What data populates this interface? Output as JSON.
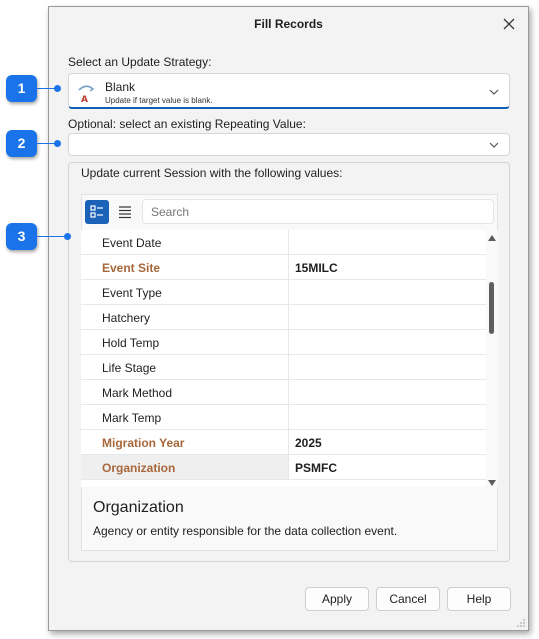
{
  "dialog": {
    "title": "Fill Records"
  },
  "strategy": {
    "label": "Select an Update Strategy:",
    "selected_name": "Blank",
    "selected_description": "Update if target value is blank."
  },
  "repeating": {
    "label": "Optional: select an existing Repeating Value:",
    "value": ""
  },
  "session": {
    "group_label": "Update current Session with the following values:",
    "search_placeholder": "Search",
    "rows": [
      {
        "name": "Event Date",
        "value": "",
        "required": false
      },
      {
        "name": "Event Site",
        "value": "15MILC",
        "required": true
      },
      {
        "name": "Event Type",
        "value": "",
        "required": false
      },
      {
        "name": "Hatchery",
        "value": "",
        "required": false
      },
      {
        "name": "Hold Temp",
        "value": "",
        "required": false
      },
      {
        "name": "Life Stage",
        "value": "",
        "required": false
      },
      {
        "name": "Mark Method",
        "value": "",
        "required": false
      },
      {
        "name": "Mark Temp",
        "value": "",
        "required": false
      },
      {
        "name": "Migration Year",
        "value": "2025",
        "required": true
      },
      {
        "name": "Organization",
        "value": "PSMFC",
        "required": true,
        "selected": true
      }
    ],
    "description_title": "Organization",
    "description_text": "Agency or entity responsible for the data collection event."
  },
  "buttons": {
    "apply": "Apply",
    "cancel": "Cancel",
    "help": "Help"
  },
  "callouts": [
    "1",
    "2",
    "3"
  ],
  "colors": {
    "accent": "#1b63b8",
    "required_text": "#a6673a",
    "callout": "#1a73e8"
  },
  "icons": [
    "close-icon",
    "blank-strategy-icon",
    "chevron-down-icon",
    "categorized-view-icon",
    "list-view-icon",
    "resize-grip-icon"
  ]
}
